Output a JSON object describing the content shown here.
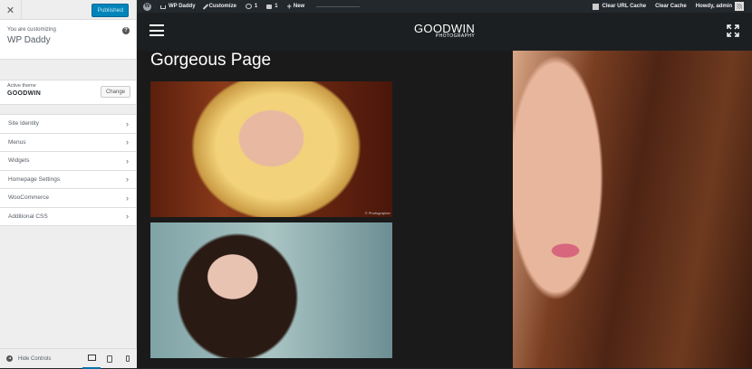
{
  "customizer": {
    "close_icon": "close-icon",
    "publish_label": "Published",
    "customizing_label": "You are customizing",
    "site_name": "WP Daddy",
    "help_icon": "?",
    "active_theme_label": "Active theme",
    "theme_name": "GOODWIN",
    "change_label": "Change",
    "sections": [
      {
        "label": "Site Identity"
      },
      {
        "label": "Menus"
      },
      {
        "label": "Widgets"
      },
      {
        "label": "Homepage Settings"
      },
      {
        "label": "WooCommerce"
      },
      {
        "label": "Additional CSS"
      }
    ],
    "hide_controls_label": "Hide Controls",
    "accent_color": "#0085ba"
  },
  "adminbar": {
    "wp_logo": "W",
    "site_name": "WP Daddy",
    "customize_label": "Customize",
    "updates_count": "1",
    "comments_count": "1",
    "new_label": "New",
    "clear_url_cache": "Clear URL Cache",
    "clear_cache": "Clear Cache",
    "howdy": "Howdy, admin"
  },
  "site": {
    "logo_main": "GOODWIN",
    "logo_sub": "PHOTOGRAPHY",
    "page_title": "Gorgeous Page",
    "image1_caption": "© Photographer"
  }
}
